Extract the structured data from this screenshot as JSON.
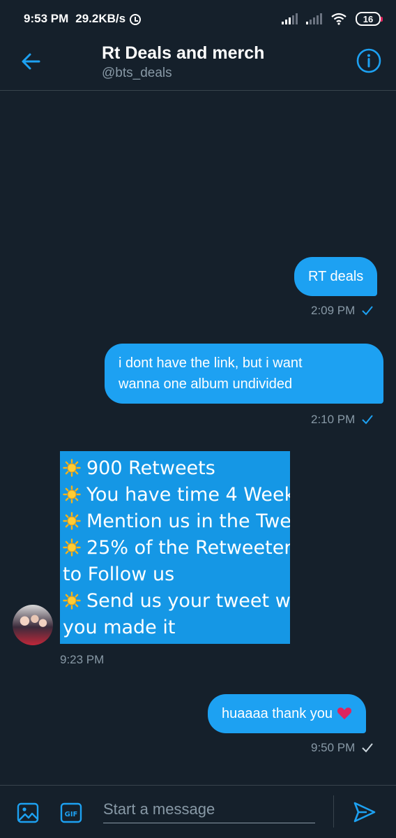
{
  "status_bar": {
    "time": "9:53 PM",
    "speed": "29.2KB/s",
    "battery": "16"
  },
  "header": {
    "title": "Rt Deals and merch",
    "handle": "@bts_deals"
  },
  "messages": [
    {
      "direction": "out",
      "text": "RT deals",
      "time": "2:09 PM"
    },
    {
      "direction": "out",
      "text_lines": [
        "i dont have the link, but i want",
        "wanna one album undivided"
      ],
      "time": "2:10 PM"
    },
    {
      "direction": "in",
      "lines": [
        {
          "icon": "sun-emoji-icon",
          "text": "900 Retweets"
        },
        {
          "icon": "sun-emoji-icon",
          "text": "You have time 4 Week"
        },
        {
          "icon": "sun-emoji-icon",
          "text": "Mention us in the Twe"
        },
        {
          "icon": "sun-emoji-icon",
          "text": "25% of the Retweeter"
        },
        {
          "icon": "",
          "text": "to Follow us"
        },
        {
          "icon": "sun-emoji-icon",
          "text": "Send us your tweet w"
        },
        {
          "icon": "",
          "text": "you made it"
        }
      ],
      "time": "9:23 PM"
    },
    {
      "direction": "out",
      "text": "huaaaa thank you",
      "time": "9:50 PM"
    }
  ],
  "composer": {
    "placeholder": "Start a message"
  },
  "colors": {
    "background": "#15202b",
    "accent": "#1da1f2",
    "secondary_text": "#8899a6",
    "heart": "#e0245e"
  }
}
